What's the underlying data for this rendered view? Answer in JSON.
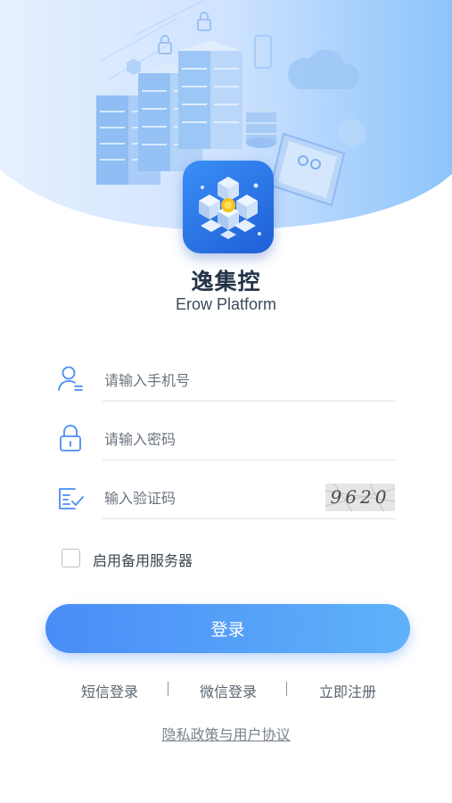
{
  "app": {
    "name": "逸集控",
    "subtitle": "Erow Platform"
  },
  "form": {
    "phone_placeholder": "请输入手机号",
    "password_placeholder": "请输入密码",
    "code_placeholder": "输入验证码",
    "captcha_text": "9620",
    "backup_server_label": "启用备用服务器",
    "backup_server_checked": false
  },
  "login_button": "登录",
  "links": {
    "sms_login": "短信登录",
    "wechat_login": "微信登录",
    "register": "立即注册"
  },
  "privacy": "隐私政策与用户协议",
  "colors": {
    "primary": "#4a8cf7",
    "gradient_end": "#5fb2f9",
    "hero_light": "#d8e9ff",
    "hero_deep": "#7fb6f8",
    "icon_blue": "#4a8cf7"
  },
  "icons": [
    "user-icon",
    "lock-icon",
    "verify-code-icon",
    "server-illustration",
    "cloud-icon",
    "database-icon",
    "monitor-icon",
    "app-logo-icon"
  ]
}
